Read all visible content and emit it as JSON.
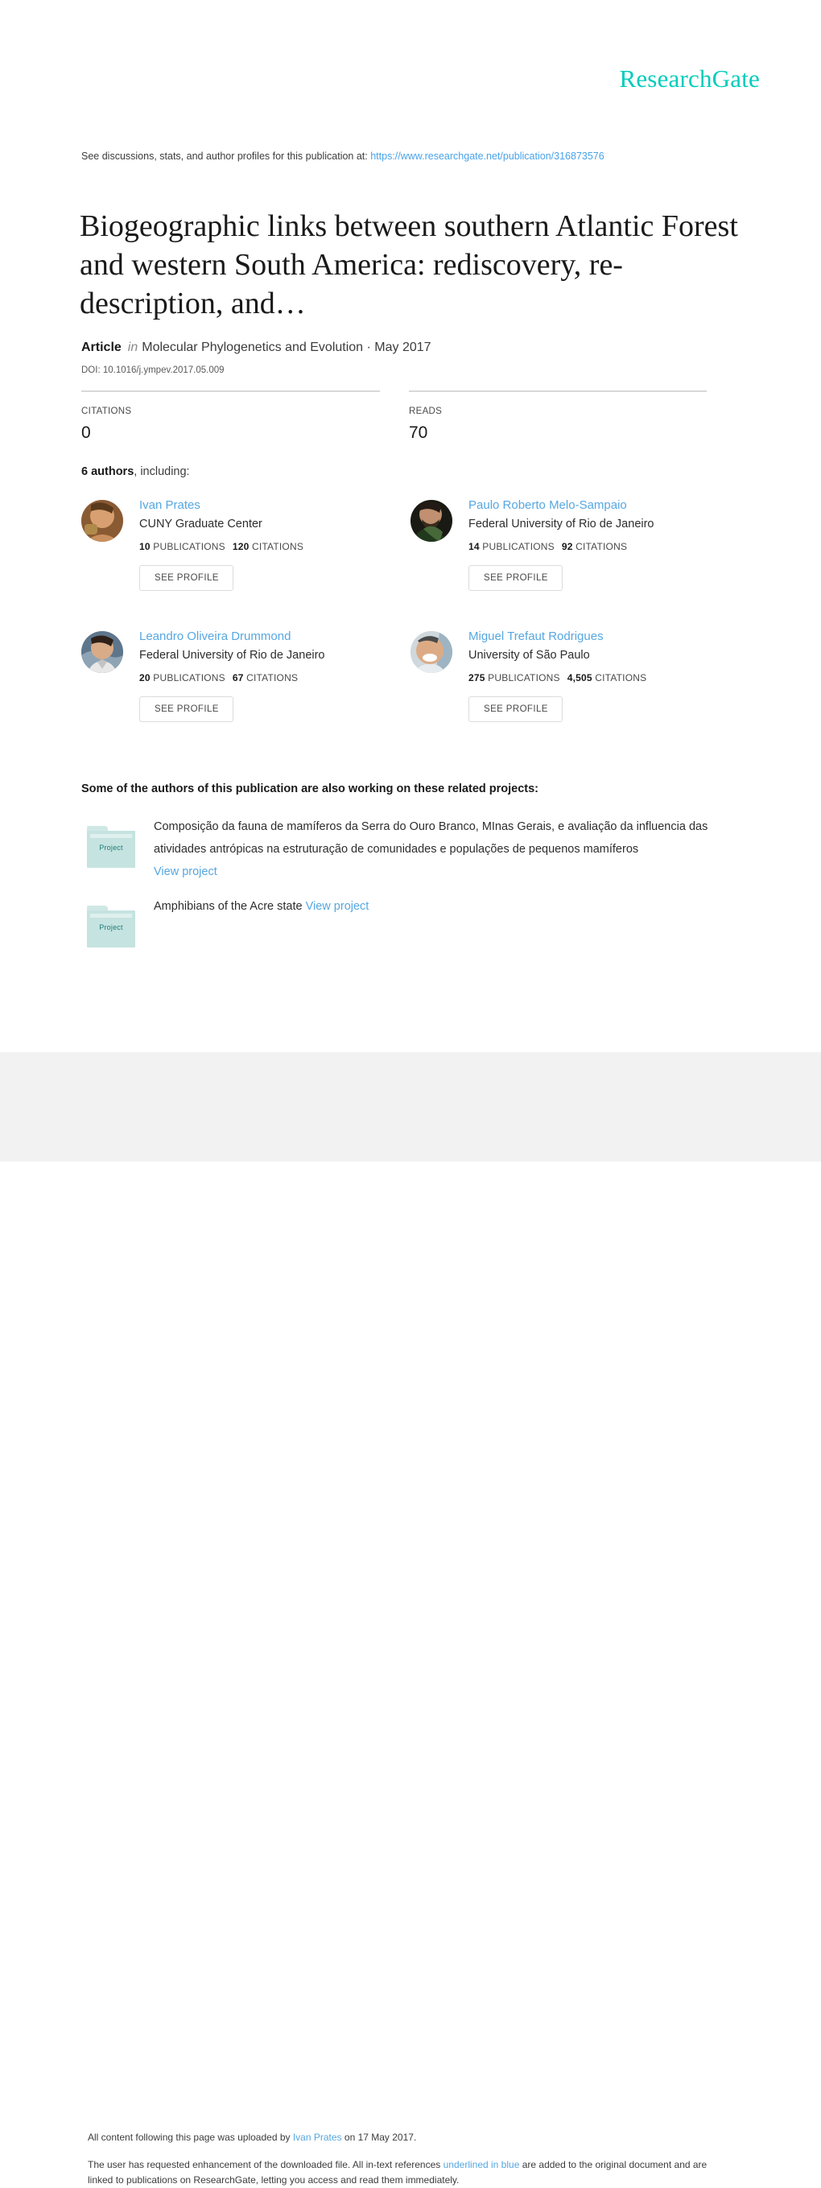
{
  "brand": {
    "name": "ResearchGate",
    "color": "#00ccbb",
    "link_color": "#56a7e0"
  },
  "header": {
    "discussion_prefix": "See discussions, stats, and author profiles for this publication at:",
    "publication_url": "https://www.researchgate.net/publication/316873576"
  },
  "publication": {
    "title": "Biogeographic links between southern Atlantic Forest and western South America: rediscovery, re-description, and…",
    "type_label": "Article",
    "in_label": "in",
    "journal_and_date": "Molecular Phylogenetics and Evolution · May 2017",
    "doi": "DOI: 10.1016/j.ympev.2017.05.009"
  },
  "metrics": [
    {
      "label": "CITATIONS",
      "value": "0"
    },
    {
      "label": "READS",
      "value": "70"
    }
  ],
  "authors_section": {
    "count_label": "6 authors",
    "suffix": ", including:",
    "see_profile_label": "SEE PROFILE",
    "publications_label": "PUBLICATIONS",
    "citations_label": "CITATIONS"
  },
  "authors": [
    {
      "name": "Ivan Prates",
      "affiliation": "CUNY Graduate Center",
      "publications": "10",
      "citations": "120"
    },
    {
      "name": "Paulo Roberto Melo-Sampaio",
      "affiliation": "Federal University of Rio de Janeiro",
      "publications": "14",
      "citations": "92"
    },
    {
      "name": "Leandro Oliveira Drummond",
      "affiliation": "Federal University of Rio de Janeiro",
      "publications": "20",
      "citations": "67"
    },
    {
      "name": "Miguel Trefaut Rodrigues",
      "affiliation": "University of São Paulo",
      "publications": "275",
      "citations": "4,505"
    }
  ],
  "projects_section": {
    "heading": "Some of the authors of this publication are also working on these related projects:",
    "folder_label": "Project",
    "view_project_label": "View project"
  },
  "projects": [
    {
      "title": "Composição da fauna de mamíferos da Serra do Ouro Branco, MInas Gerais, e avaliação da influencia das atividades antrópicas na estruturação de comunidades e populações de pequenos mamíferos",
      "inline": false
    },
    {
      "title": "Amphibians of the Acre state",
      "inline": true
    }
  ],
  "footer": {
    "upload_prefix": "All content following this page was uploaded by",
    "uploader": "Ivan Prates",
    "upload_suffix": "on 17 May 2017.",
    "enhancement_1": "The user has requested enhancement of the downloaded file. All in-text references",
    "enhancement_link": "underlined in blue",
    "enhancement_2": "are added to the original document and are linked to publications on ResearchGate, letting you access and read them immediately."
  }
}
